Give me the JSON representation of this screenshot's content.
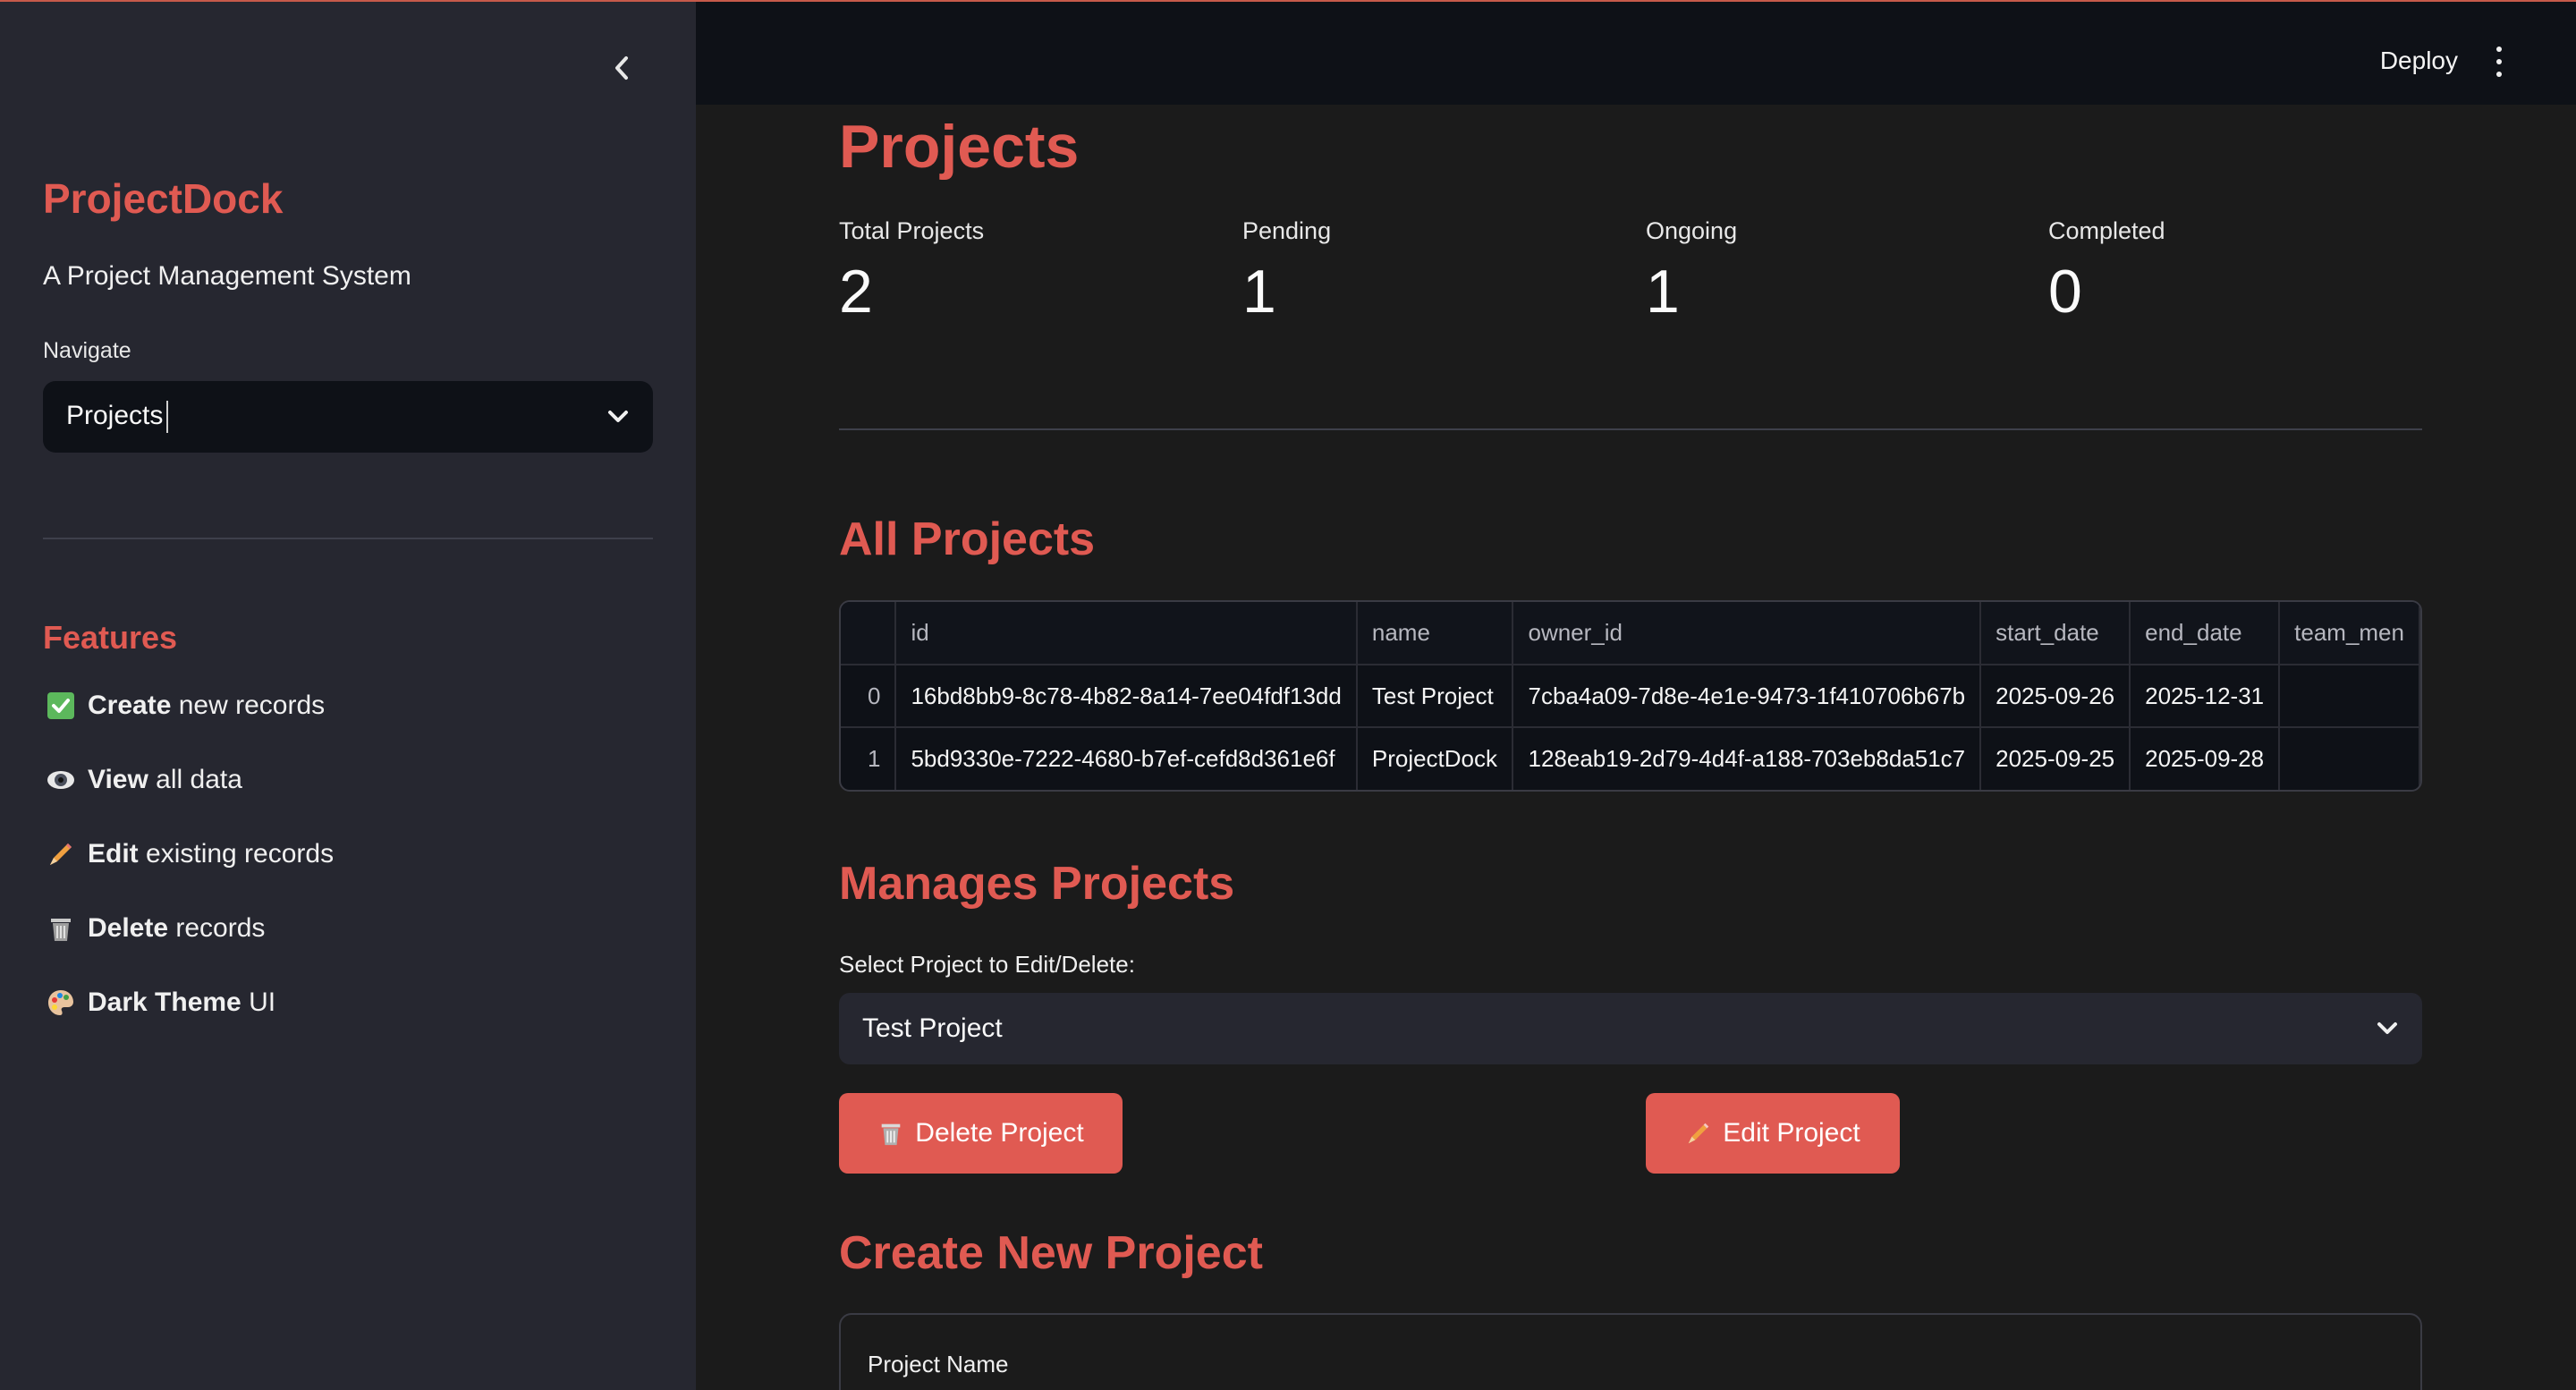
{
  "sidebar": {
    "title": "ProjectDock",
    "subtitle": "A Project Management System",
    "nav_label": "Navigate",
    "nav_selected": "Projects",
    "features_title": "Features",
    "features": [
      {
        "icon": "check-box-icon",
        "bold": "Create",
        "rest": " new records"
      },
      {
        "icon": "eye-icon",
        "bold": "View",
        "rest": " all data"
      },
      {
        "icon": "pencil-icon",
        "bold": "Edit",
        "rest": " existing records"
      },
      {
        "icon": "trash-icon",
        "bold": "Delete",
        "rest": " records"
      },
      {
        "icon": "palette-icon",
        "bold": "Dark Theme",
        "rest": " UI"
      }
    ]
  },
  "header": {
    "deploy_label": "Deploy"
  },
  "main": {
    "title": "Projects",
    "metrics": [
      {
        "label": "Total Projects",
        "value": "2"
      },
      {
        "label": "Pending",
        "value": "1"
      },
      {
        "label": "Ongoing",
        "value": "1"
      },
      {
        "label": "Completed",
        "value": "0"
      }
    ],
    "all_projects_title": "All Projects",
    "table": {
      "columns": [
        "",
        "id",
        "name",
        "owner_id",
        "start_date",
        "end_date",
        "team_men"
      ],
      "rows": [
        [
          "0",
          "16bd8bb9-8c78-4b82-8a14-7ee04fdf13dd",
          "Test Project",
          "7cba4a09-7d8e-4e1e-9473-1f410706b67b",
          "2025-09-26",
          "2025-12-31",
          ""
        ],
        [
          "1",
          "5bd9330e-7222-4680-b7ef-cefd8d361e6f",
          "ProjectDock",
          "128eab19-2d79-4d4f-a188-703eb8da51c7",
          "2025-09-25",
          "2025-09-28",
          ""
        ]
      ]
    },
    "manage_title": "Manages Projects",
    "select_label": "Select Project to Edit/Delete:",
    "select_value": "Test Project",
    "delete_label": "Delete Project",
    "edit_label": "Edit Project",
    "create_title": "Create New Project",
    "form_field_label": "Project Name"
  },
  "colors": {
    "accent": "#e05a52",
    "sidebar_bg": "#262730",
    "main_bg": "#1b1b1b",
    "header_bg": "#0e1117"
  }
}
